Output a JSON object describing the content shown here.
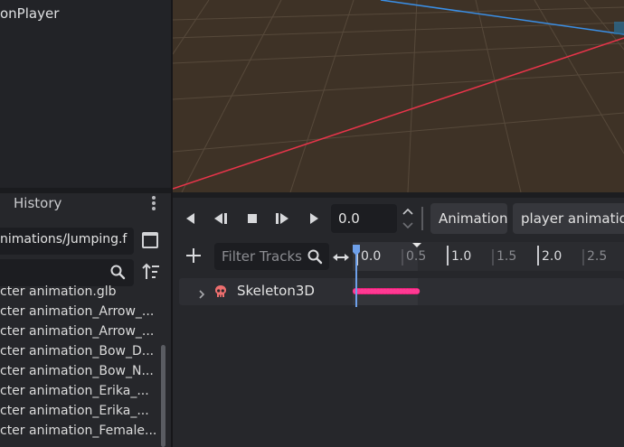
{
  "scene": {
    "node_label": "onPlayer"
  },
  "filesystem": {
    "tab_history": "History",
    "path_value": "nimations/Jumping.f",
    "search_value": "",
    "files": [
      "cter animation.glb",
      "cter animation_Arrow_...",
      "cter animation_Arrow_...",
      "cter animation_Bow_D...",
      "cter animation_Bow_N...",
      "cter animation_Erika_...",
      "cter animation_Erika_...",
      "cter animation_Female..."
    ]
  },
  "viewport": {
    "background": "#3e3226",
    "x_axis_color": "#e8344a",
    "z_axis_color": "#3a8fe6",
    "grid_color": "#6b5c4c"
  },
  "animation": {
    "time_value": "0.0",
    "animation_menu_label": "Animation",
    "animation_select_value": "player animation/",
    "filter_placeholder": "Filter Tracks",
    "ruler_labels": [
      "0.0",
      "0.5",
      "1.0",
      "1.5",
      "2.0",
      "2.5"
    ],
    "playhead_time": 0.0,
    "animation_length": 0.7,
    "tracks": [
      {
        "label": "Skeleton3D"
      }
    ],
    "colors": {
      "playhead": "#6ea0ea",
      "keyframe": "#e8207a",
      "skeleton_icon": "#ee6f6f"
    }
  }
}
